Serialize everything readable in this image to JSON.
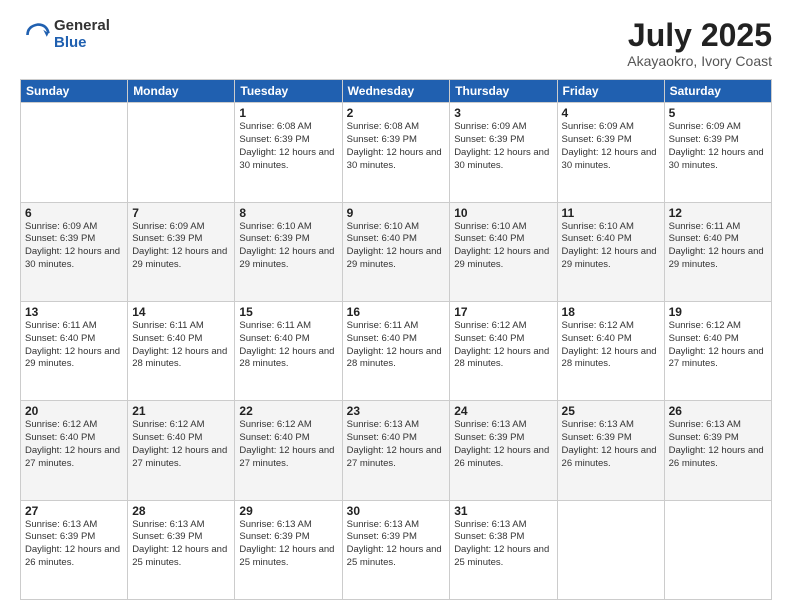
{
  "logo": {
    "general": "General",
    "blue": "Blue"
  },
  "header": {
    "month": "July 2025",
    "location": "Akayaokro, Ivory Coast"
  },
  "days": [
    "Sunday",
    "Monday",
    "Tuesday",
    "Wednesday",
    "Thursday",
    "Friday",
    "Saturday"
  ],
  "weeks": [
    [
      {
        "day": "",
        "sunrise": "",
        "sunset": "",
        "daylight": ""
      },
      {
        "day": "",
        "sunrise": "",
        "sunset": "",
        "daylight": ""
      },
      {
        "day": "1",
        "sunrise": "Sunrise: 6:08 AM",
        "sunset": "Sunset: 6:39 PM",
        "daylight": "Daylight: 12 hours and 30 minutes."
      },
      {
        "day": "2",
        "sunrise": "Sunrise: 6:08 AM",
        "sunset": "Sunset: 6:39 PM",
        "daylight": "Daylight: 12 hours and 30 minutes."
      },
      {
        "day": "3",
        "sunrise": "Sunrise: 6:09 AM",
        "sunset": "Sunset: 6:39 PM",
        "daylight": "Daylight: 12 hours and 30 minutes."
      },
      {
        "day": "4",
        "sunrise": "Sunrise: 6:09 AM",
        "sunset": "Sunset: 6:39 PM",
        "daylight": "Daylight: 12 hours and 30 minutes."
      },
      {
        "day": "5",
        "sunrise": "Sunrise: 6:09 AM",
        "sunset": "Sunset: 6:39 PM",
        "daylight": "Daylight: 12 hours and 30 minutes."
      }
    ],
    [
      {
        "day": "6",
        "sunrise": "Sunrise: 6:09 AM",
        "sunset": "Sunset: 6:39 PM",
        "daylight": "Daylight: 12 hours and 30 minutes."
      },
      {
        "day": "7",
        "sunrise": "Sunrise: 6:09 AM",
        "sunset": "Sunset: 6:39 PM",
        "daylight": "Daylight: 12 hours and 29 minutes."
      },
      {
        "day": "8",
        "sunrise": "Sunrise: 6:10 AM",
        "sunset": "Sunset: 6:39 PM",
        "daylight": "Daylight: 12 hours and 29 minutes."
      },
      {
        "day": "9",
        "sunrise": "Sunrise: 6:10 AM",
        "sunset": "Sunset: 6:40 PM",
        "daylight": "Daylight: 12 hours and 29 minutes."
      },
      {
        "day": "10",
        "sunrise": "Sunrise: 6:10 AM",
        "sunset": "Sunset: 6:40 PM",
        "daylight": "Daylight: 12 hours and 29 minutes."
      },
      {
        "day": "11",
        "sunrise": "Sunrise: 6:10 AM",
        "sunset": "Sunset: 6:40 PM",
        "daylight": "Daylight: 12 hours and 29 minutes."
      },
      {
        "day": "12",
        "sunrise": "Sunrise: 6:11 AM",
        "sunset": "Sunset: 6:40 PM",
        "daylight": "Daylight: 12 hours and 29 minutes."
      }
    ],
    [
      {
        "day": "13",
        "sunrise": "Sunrise: 6:11 AM",
        "sunset": "Sunset: 6:40 PM",
        "daylight": "Daylight: 12 hours and 29 minutes."
      },
      {
        "day": "14",
        "sunrise": "Sunrise: 6:11 AM",
        "sunset": "Sunset: 6:40 PM",
        "daylight": "Daylight: 12 hours and 28 minutes."
      },
      {
        "day": "15",
        "sunrise": "Sunrise: 6:11 AM",
        "sunset": "Sunset: 6:40 PM",
        "daylight": "Daylight: 12 hours and 28 minutes."
      },
      {
        "day": "16",
        "sunrise": "Sunrise: 6:11 AM",
        "sunset": "Sunset: 6:40 PM",
        "daylight": "Daylight: 12 hours and 28 minutes."
      },
      {
        "day": "17",
        "sunrise": "Sunrise: 6:12 AM",
        "sunset": "Sunset: 6:40 PM",
        "daylight": "Daylight: 12 hours and 28 minutes."
      },
      {
        "day": "18",
        "sunrise": "Sunrise: 6:12 AM",
        "sunset": "Sunset: 6:40 PM",
        "daylight": "Daylight: 12 hours and 28 minutes."
      },
      {
        "day": "19",
        "sunrise": "Sunrise: 6:12 AM",
        "sunset": "Sunset: 6:40 PM",
        "daylight": "Daylight: 12 hours and 27 minutes."
      }
    ],
    [
      {
        "day": "20",
        "sunrise": "Sunrise: 6:12 AM",
        "sunset": "Sunset: 6:40 PM",
        "daylight": "Daylight: 12 hours and 27 minutes."
      },
      {
        "day": "21",
        "sunrise": "Sunrise: 6:12 AM",
        "sunset": "Sunset: 6:40 PM",
        "daylight": "Daylight: 12 hours and 27 minutes."
      },
      {
        "day": "22",
        "sunrise": "Sunrise: 6:12 AM",
        "sunset": "Sunset: 6:40 PM",
        "daylight": "Daylight: 12 hours and 27 minutes."
      },
      {
        "day": "23",
        "sunrise": "Sunrise: 6:13 AM",
        "sunset": "Sunset: 6:40 PM",
        "daylight": "Daylight: 12 hours and 27 minutes."
      },
      {
        "day": "24",
        "sunrise": "Sunrise: 6:13 AM",
        "sunset": "Sunset: 6:39 PM",
        "daylight": "Daylight: 12 hours and 26 minutes."
      },
      {
        "day": "25",
        "sunrise": "Sunrise: 6:13 AM",
        "sunset": "Sunset: 6:39 PM",
        "daylight": "Daylight: 12 hours and 26 minutes."
      },
      {
        "day": "26",
        "sunrise": "Sunrise: 6:13 AM",
        "sunset": "Sunset: 6:39 PM",
        "daylight": "Daylight: 12 hours and 26 minutes."
      }
    ],
    [
      {
        "day": "27",
        "sunrise": "Sunrise: 6:13 AM",
        "sunset": "Sunset: 6:39 PM",
        "daylight": "Daylight: 12 hours and 26 minutes."
      },
      {
        "day": "28",
        "sunrise": "Sunrise: 6:13 AM",
        "sunset": "Sunset: 6:39 PM",
        "daylight": "Daylight: 12 hours and 25 minutes."
      },
      {
        "day": "29",
        "sunrise": "Sunrise: 6:13 AM",
        "sunset": "Sunset: 6:39 PM",
        "daylight": "Daylight: 12 hours and 25 minutes."
      },
      {
        "day": "30",
        "sunrise": "Sunrise: 6:13 AM",
        "sunset": "Sunset: 6:39 PM",
        "daylight": "Daylight: 12 hours and 25 minutes."
      },
      {
        "day": "31",
        "sunrise": "Sunrise: 6:13 AM",
        "sunset": "Sunset: 6:38 PM",
        "daylight": "Daylight: 12 hours and 25 minutes."
      },
      {
        "day": "",
        "sunrise": "",
        "sunset": "",
        "daylight": ""
      },
      {
        "day": "",
        "sunrise": "",
        "sunset": "",
        "daylight": ""
      }
    ]
  ]
}
